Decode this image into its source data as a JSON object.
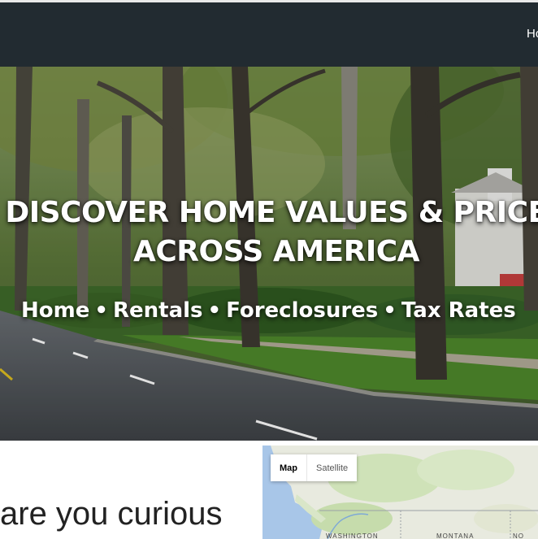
{
  "header": {
    "nav_home": "Ho"
  },
  "hero": {
    "title_line1": "DISCOVER HOME VALUES & PRICE",
    "title_line2": "ACROSS AMERICA",
    "links": [
      "Home",
      "Rentals",
      "Foreclosures",
      "Tax Rates"
    ],
    "separator": "•"
  },
  "main": {
    "heading": "are you curious"
  },
  "map": {
    "toggle_map": "Map",
    "toggle_satellite": "Satellite",
    "label_washington": "WASHINGTON",
    "label_montana": "MONTANA",
    "label_north": "NO"
  }
}
